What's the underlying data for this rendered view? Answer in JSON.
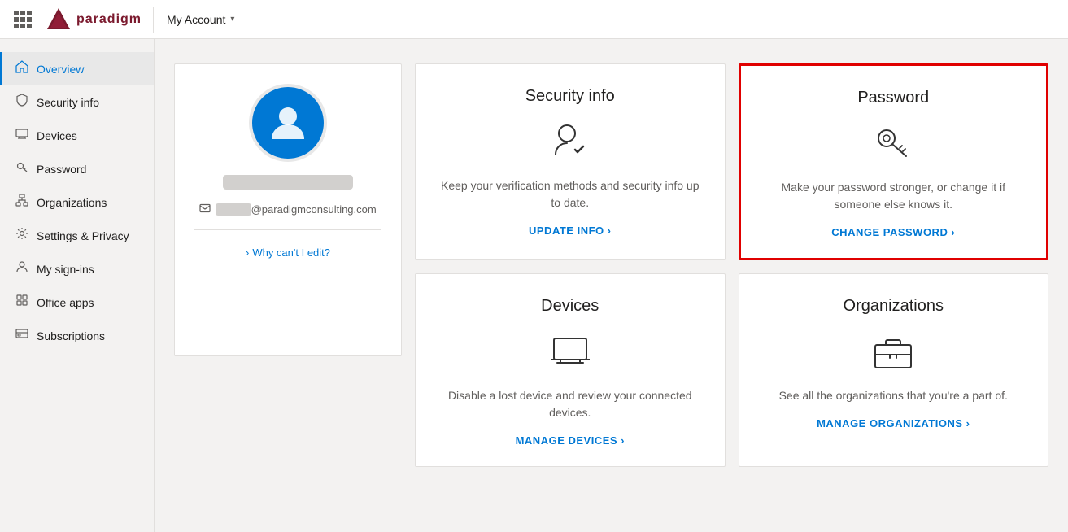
{
  "topbar": {
    "account_label": "My Account",
    "logo_text": "paradigm"
  },
  "sidebar": {
    "items": [
      {
        "id": "overview",
        "label": "Overview",
        "icon": "home",
        "active": true
      },
      {
        "id": "security-info",
        "label": "Security info",
        "icon": "shield"
      },
      {
        "id": "devices",
        "label": "Devices",
        "icon": "devices"
      },
      {
        "id": "password",
        "label": "Password",
        "icon": "password"
      },
      {
        "id": "organizations",
        "label": "Organizations",
        "icon": "org"
      },
      {
        "id": "settings-privacy",
        "label": "Settings & Privacy",
        "icon": "settings"
      },
      {
        "id": "my-sign-ins",
        "label": "My sign-ins",
        "icon": "signin"
      },
      {
        "id": "office-apps",
        "label": "Office apps",
        "icon": "office"
      },
      {
        "id": "subscriptions",
        "label": "Subscriptions",
        "icon": "subscriptions"
      }
    ]
  },
  "profile": {
    "email_domain": "@paradigmconsulting.com",
    "why_cant_edit": "Why can't I edit?"
  },
  "cards": [
    {
      "id": "security-info",
      "title": "Security info",
      "description": "Keep your verification methods and security info up to date.",
      "action_label": "UPDATE INFO",
      "action_chevron": "›",
      "highlighted": false
    },
    {
      "id": "password",
      "title": "Password",
      "description": "Make your password stronger, or change it if someone else knows it.",
      "action_label": "CHANGE PASSWORD",
      "action_chevron": "›",
      "highlighted": true
    },
    {
      "id": "devices",
      "title": "Devices",
      "description": "Disable a lost device and review your connected devices.",
      "action_label": "MANAGE DEVICES",
      "action_chevron": "›",
      "highlighted": false
    },
    {
      "id": "organizations",
      "title": "Organizations",
      "description": "See all the organizations that you're a part of.",
      "action_label": "MANAGE ORGANIZATIONS",
      "action_chevron": "›",
      "highlighted": false
    }
  ]
}
